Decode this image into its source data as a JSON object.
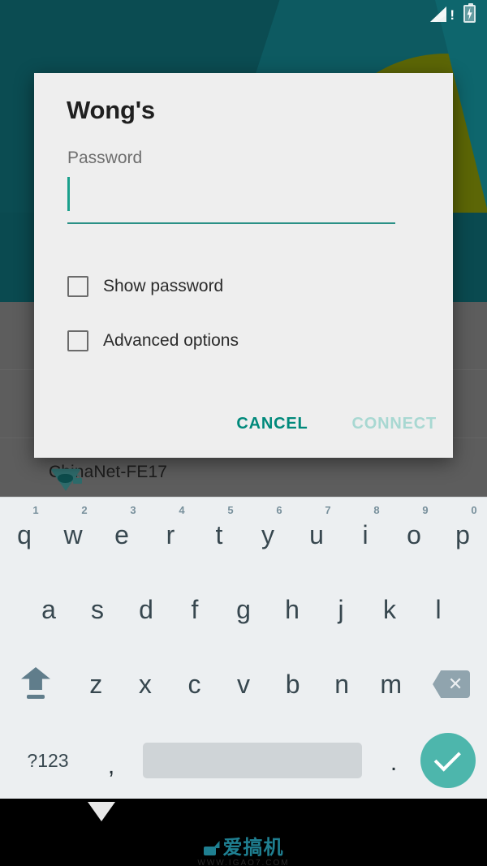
{
  "status_bar": {
    "signal_icon": "signal-bars-warning-icon",
    "battery_icon": "battery-charging-icon"
  },
  "wallpaper": {
    "base_color": "#0a4f56",
    "accent_color": "#5c6606"
  },
  "background_list": {
    "rows": [
      {
        "name": "",
        "icon": ""
      },
      {
        "name": "",
        "icon": ""
      },
      {
        "name": "ChinaNet-FE17",
        "icon": "wifi-secured-icon"
      }
    ]
  },
  "dialog": {
    "title": "Wong's",
    "password_label": "Password",
    "password_value": "",
    "password_placeholder": "",
    "checkboxes": [
      {
        "label": "Show password",
        "checked": false
      },
      {
        "label": "Advanced options",
        "checked": false
      }
    ],
    "cancel_label": "CANCEL",
    "connect_label": "CONNECT",
    "cancel_color": "#00897b",
    "connect_color": "#a8d8d2",
    "accent_color": "#2a9086"
  },
  "keyboard": {
    "row1": [
      {
        "key": "q",
        "sup": "1"
      },
      {
        "key": "w",
        "sup": "2"
      },
      {
        "key": "e",
        "sup": "3"
      },
      {
        "key": "r",
        "sup": "4"
      },
      {
        "key": "t",
        "sup": "5"
      },
      {
        "key": "y",
        "sup": "6"
      },
      {
        "key": "u",
        "sup": "7"
      },
      {
        "key": "i",
        "sup": "8"
      },
      {
        "key": "o",
        "sup": "9"
      },
      {
        "key": "p",
        "sup": "0"
      }
    ],
    "row2": [
      "a",
      "s",
      "d",
      "f",
      "g",
      "h",
      "j",
      "k",
      "l"
    ],
    "row3": [
      "z",
      "x",
      "c",
      "v",
      "b",
      "n",
      "m"
    ],
    "shift_icon": "shift-up-arrow-icon",
    "backspace_icon": "backspace-delete-icon",
    "symbols_label": "?123",
    "comma_label": ",",
    "space_label": "",
    "period_label": ".",
    "enter_icon": "check-enter-icon",
    "enter_color": "#4db6ac"
  },
  "nav_bar": {
    "back_icon": "hide-keyboard-triangle-icon",
    "watermark": "爱搞机",
    "watermark_url": "WWW.IGAO7.COM"
  }
}
